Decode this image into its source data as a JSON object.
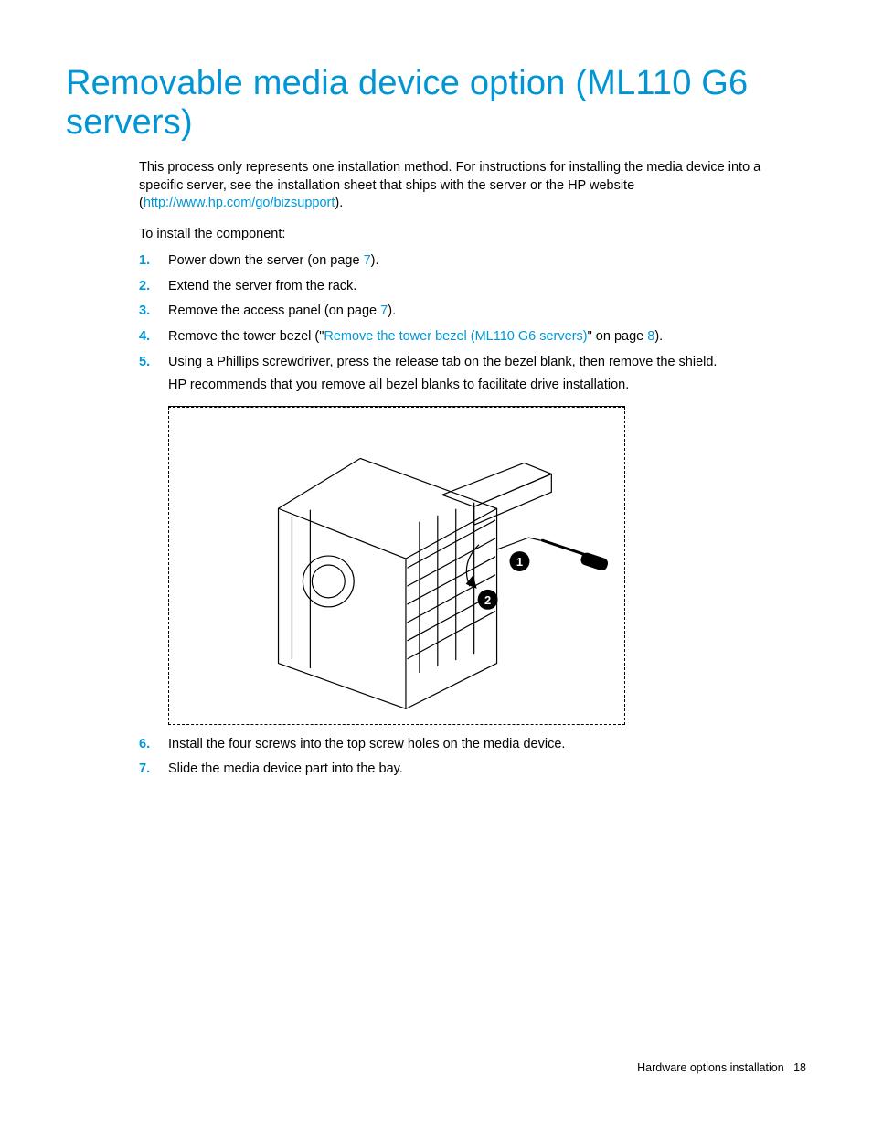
{
  "title": "Removable media device option (ML110 G6 servers)",
  "intro": {
    "lead": "This process only represents one installation method. For instructions for installing the media device into a specific server, see the installation sheet that ships with the server or the HP website (",
    "link_text": "http://www.hp.com/go/bizsupport",
    "tail": ")."
  },
  "install_label": "To install the component:",
  "steps": [
    {
      "n": "1.",
      "pre": "Power down the server (on page ",
      "link": "7",
      "post": ")."
    },
    {
      "n": "2.",
      "pre": "Extend the server from the rack.",
      "link": "",
      "post": ""
    },
    {
      "n": "3.",
      "pre": "Remove the access panel (on page ",
      "link": "7",
      "post": ")."
    },
    {
      "n": "4.",
      "pre": "Remove the tower bezel (\"",
      "link": "Remove the tower bezel (ML110 G6 servers)",
      "post": "\" on page ",
      "link2": "8",
      "post2": ")."
    },
    {
      "n": "5.",
      "pre": "Using a Phillips screwdriver, press the release tab on the bezel blank, then remove the shield.",
      "sub": "HP recommends that you remove all bezel blanks to facilitate drive installation."
    },
    {
      "n": "6.",
      "pre": "Install the four screws into the top screw holes on the media device."
    },
    {
      "n": "7.",
      "pre": "Slide the media device part into the bay."
    }
  ],
  "figure": {
    "callouts": [
      "1",
      "2"
    ]
  },
  "footer": {
    "section": "Hardware options installation",
    "page": "18"
  }
}
